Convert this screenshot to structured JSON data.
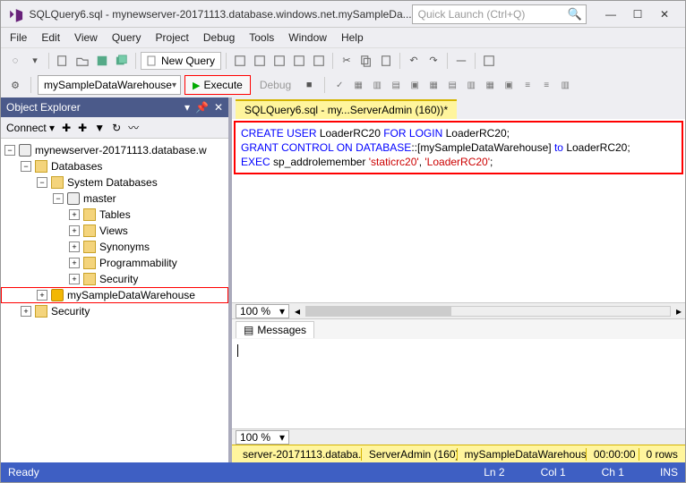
{
  "title": "SQLQuery6.sql - mynewserver-20171113.database.windows.net.mySampleDa...",
  "quick_launch": {
    "placeholder": "Quick Launch (Ctrl+Q)"
  },
  "menu": [
    "File",
    "Edit",
    "View",
    "Query",
    "Project",
    "Debug",
    "Tools",
    "Window",
    "Help"
  ],
  "toolbar": {
    "new_query": "New Query"
  },
  "toolbar2": {
    "db_combo": "mySampleDataWarehouse",
    "execute": "Execute",
    "debug": "Debug"
  },
  "objexp": {
    "title": "Object Explorer",
    "connect": "Connect ▾",
    "tree": {
      "server": "mynewserver-20171113.database.w",
      "databases": "Databases",
      "system_db": "System Databases",
      "master": "master",
      "nodes": [
        "Tables",
        "Views",
        "Synonyms",
        "Programmability",
        "Security"
      ],
      "highlight": "mySampleDataWarehouse",
      "security": "Security"
    }
  },
  "tab": {
    "label": "SQLQuery6.sql - my...ServerAdmin (160))*"
  },
  "sql": {
    "l1a": "CREATE",
    "l1b": "USER",
    "l1c": "LoaderRC20",
    "l1d": "FOR",
    "l1e": "LOGIN",
    "l1f": "LoaderRC20",
    "l2a": "GRANT",
    "l2b": "CONTROL",
    "l2c": "ON",
    "l2d": "DATABASE",
    "l2e": "::[mySampleDataWarehouse]",
    "l2f": "to",
    "l2g": "LoaderRC20",
    "l3a": "EXEC",
    "l3b": "sp_addrolemember",
    "l3c": "'staticrc20'",
    "l3d": ",",
    "l3e": "'LoaderRC20'"
  },
  "zoom": "100 %",
  "messages": {
    "tab": "Messages"
  },
  "zoom2": "100 %",
  "status2": {
    "server": "server-20171113.databa...",
    "user": "ServerAdmin (160)",
    "db": "mySampleDataWarehouse",
    "time": "00:00:00",
    "rows": "0 rows"
  },
  "footer": {
    "ready": "Ready",
    "ln": "Ln 2",
    "col": "Col 1",
    "ch": "Ch 1",
    "ins": "INS"
  }
}
